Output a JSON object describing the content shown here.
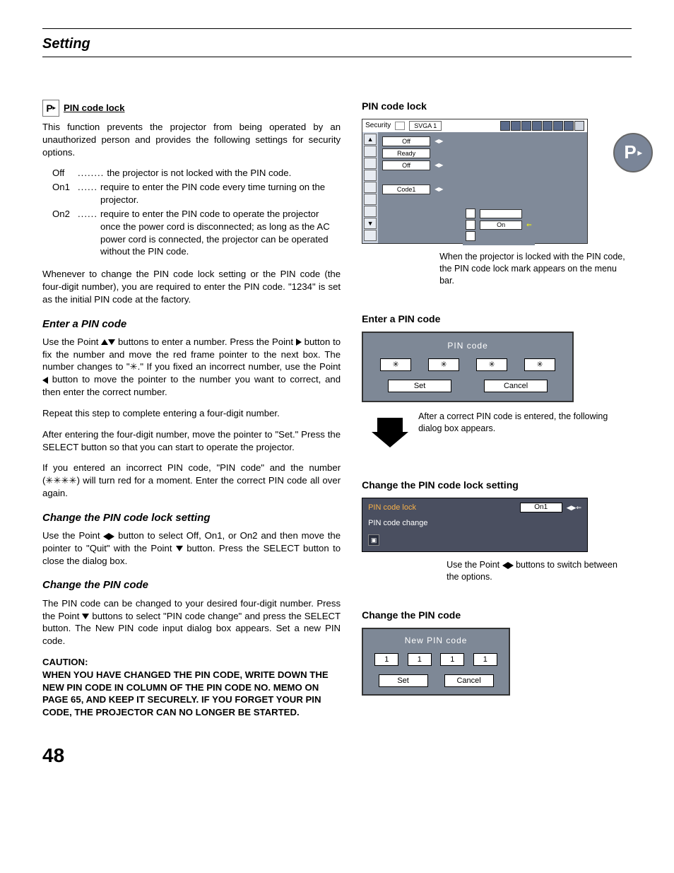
{
  "header": {
    "title": "Setting"
  },
  "page_number": "48",
  "left": {
    "pin_icon_text": "P",
    "heading_pin_lock": "PIN code lock",
    "intro": "This function prevents the projector from being operated by an unauthorized person and provides the following settings for security options.",
    "options": [
      {
        "key": "Off",
        "dots": "........",
        "val": "the projector is not locked with the PIN code."
      },
      {
        "key": "On1",
        "dots": "......",
        "val": "require to enter the PIN code every time turning on the projector."
      },
      {
        "key": "On2",
        "dots": "......",
        "val": "require to enter the PIN code to operate the projector once the power cord is disconnected; as long as the AC power cord is connected, the projector can be operated without the PIN code."
      }
    ],
    "whenever": "Whenever to change the PIN code lock setting or the PIN code (the four-digit number), you are required to enter the PIN code.  \"1234\" is set as the initial PIN code at the factory.",
    "h_enter": "Enter a PIN code",
    "enter_p1a": "Use the Point ",
    "enter_p1b": " buttons to enter a number. Press the Point ",
    "enter_p1c": " button to fix the number and move the red frame pointer to the next box. The number changes to \"✳.\" If you fixed an incorrect number, use the Point ",
    "enter_p1d": " button to move the pointer to the number you want to correct, and then enter the correct number.",
    "enter_p2": "Repeat this step to complete entering a four-digit number.",
    "enter_p3": "After entering the four-digit number, move the pointer to \"Set.\" Press the SELECT button so that you can start to operate the projector.",
    "enter_p4": "If you entered an incorrect PIN code, \"PIN code\" and the number (✳✳✳✳) will turn red for a moment. Enter the correct PIN code all over again.",
    "h_change_setting": "Change the PIN code lock setting",
    "change_setting_a": "Use the Point ",
    "change_setting_b": " button to select Off, On1, or On2 and then move the pointer to \"Quit\" with the Point ",
    "change_setting_c": " button. Press the SELECT button to close the dialog box.",
    "h_change_code": "Change the PIN code",
    "change_code_a": "The PIN code can be changed to your desired four-digit number. Press the Point ",
    "change_code_b": " buttons to select \"PIN code change\" and press the SELECT button. The New PIN code input dialog box appears. Set a new PIN code.",
    "caution_label": "CAUTION:",
    "caution_body": "WHEN YOU HAVE CHANGED THE PIN CODE, WRITE DOWN THE NEW PIN CODE IN COLUMN OF THE PIN CODE NO. MEMO ON PAGE 65, AND KEEP IT SECURELY. IF YOU FORGET YOUR PIN CODE, THE PROJECTOR CAN NO LONGER BE STARTED."
  },
  "right": {
    "h1": "PIN code lock",
    "osd1": {
      "topbar_label": "Security",
      "topbar_tag": "SVGA 1",
      "rows": [
        "Off",
        "Ready",
        "Off",
        "",
        "Code1"
      ],
      "inner_on": "On",
      "big_p": "P"
    },
    "caption1": "When the projector is locked with the PIN code, the PIN code lock mark appears on the menu bar.",
    "h2": "Enter a PIN code",
    "pin_dialog": {
      "title": "PIN code",
      "digits": [
        "✳",
        "✳",
        "✳",
        "✳"
      ],
      "set": "Set",
      "cancel": "Cancel"
    },
    "caption2": "After a correct PIN code is entered, the following dialog box appears.",
    "h3": "Change the PIN code lock setting",
    "change_dialog": {
      "row1_label": "PIN code lock",
      "row1_value": "On1",
      "row2_label": "PIN code change"
    },
    "caption3a": "Use the Point ",
    "caption3b": " buttons to switch between the options.",
    "h4": "Change the PIN code",
    "new_pin": {
      "title": "New PIN code",
      "digits": [
        "1",
        "1",
        "1",
        "1"
      ],
      "set": "Set",
      "cancel": "Cancel"
    }
  }
}
